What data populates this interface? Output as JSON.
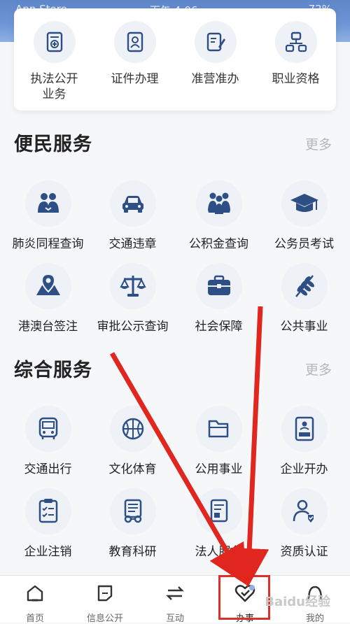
{
  "status_bar": {
    "carrier": "App Store",
    "time": "下午 4:06",
    "battery": "72%"
  },
  "top_services": [
    {
      "label": "执法公开\n业务",
      "icon": "law-doc-icon"
    },
    {
      "label": "证件办理",
      "icon": "id-card-icon"
    },
    {
      "label": "准营准办",
      "icon": "pen-doc-icon"
    },
    {
      "label": "职业资格",
      "icon": "org-chart-icon"
    }
  ],
  "convenience": {
    "title": "便民服务",
    "more": "更多",
    "items": [
      {
        "label": "肺炎同程查询",
        "icon": "lungs-icon"
      },
      {
        "label": "交通违章",
        "icon": "car-icon"
      },
      {
        "label": "公积金查询",
        "icon": "people-icon"
      },
      {
        "label": "公务员考试",
        "icon": "graduation-cap-icon"
      },
      {
        "label": "港澳台签注",
        "icon": "map-pin-icon"
      },
      {
        "label": "审批公示查询",
        "icon": "scale-icon"
      },
      {
        "label": "社会保障",
        "icon": "toolbox-icon"
      },
      {
        "label": "公共事业",
        "icon": "wheat-icon"
      }
    ]
  },
  "integrated": {
    "title": "综合服务",
    "more": "更多",
    "items": [
      {
        "label": "交通出行",
        "icon": "bus-icon"
      },
      {
        "label": "文化体育",
        "icon": "basketball-icon"
      },
      {
        "label": "公用事业",
        "icon": "folder-icon"
      },
      {
        "label": "企业开办",
        "icon": "certificate-icon"
      },
      {
        "label": "企业注销",
        "icon": "checklist-icon"
      },
      {
        "label": "教育科研",
        "icon": "glasses-doc-icon"
      },
      {
        "label": "法人服务",
        "icon": "legal-doc-icon"
      },
      {
        "label": "资质认证",
        "icon": "verified-person-icon"
      }
    ]
  },
  "bottom_nav": [
    {
      "label": "首页",
      "icon": "home-icon"
    },
    {
      "label": "信息公开",
      "icon": "info-icon"
    },
    {
      "label": "互动",
      "icon": "exchange-icon"
    },
    {
      "label": "办事",
      "icon": "heart-check-icon",
      "active": true
    },
    {
      "label": "我的",
      "icon": "profile-icon"
    }
  ],
  "watermark": "Baidu经验",
  "colors": {
    "icon": "#2d4f86",
    "annotation": "#e0261f",
    "status_bar": "#6f97d6"
  }
}
